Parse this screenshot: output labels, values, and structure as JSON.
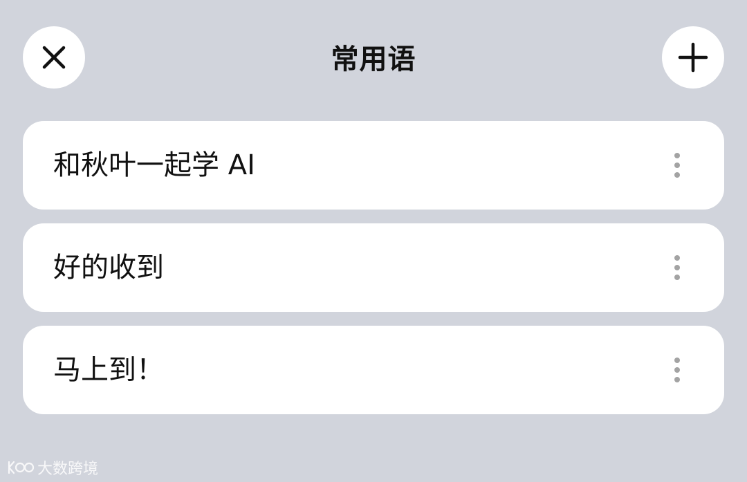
{
  "header": {
    "title": "常用语",
    "close_icon": "close-icon",
    "add_icon": "plus-icon"
  },
  "phrases": [
    {
      "label": "和秋叶一起学 AI",
      "more_icon": "more-vertical-icon"
    },
    {
      "label": "好的收到",
      "more_icon": "more-vertical-icon"
    },
    {
      "label": "马上到！",
      "more_icon": "more-vertical-icon"
    }
  ],
  "watermark": {
    "text": "大数跨境",
    "logo_text": "K100"
  },
  "colors": {
    "background": "#d1d4dc",
    "card": "#ffffff",
    "text": "#111111",
    "more_dots": "#a3a3a3"
  }
}
